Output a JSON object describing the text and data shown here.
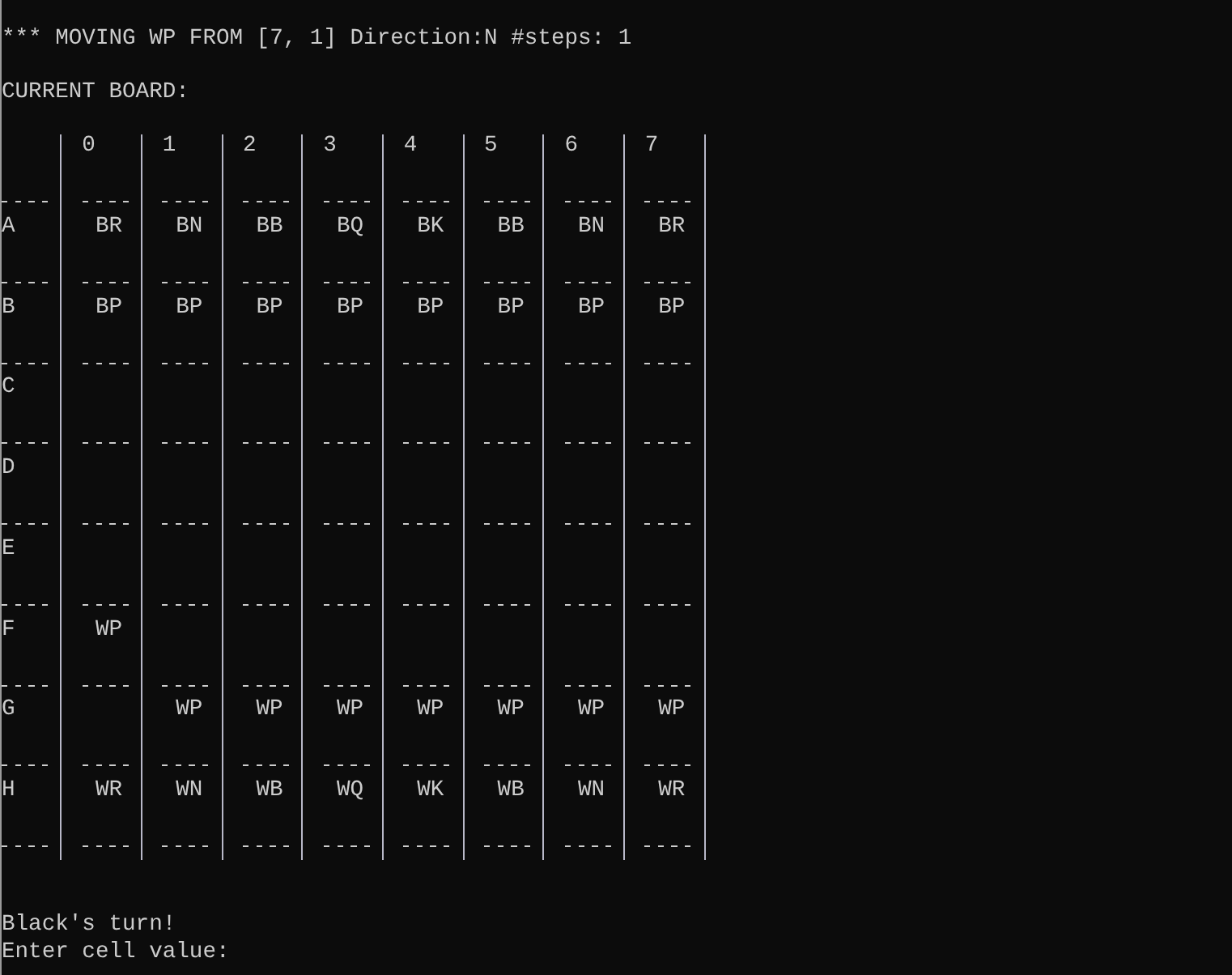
{
  "move_message": "*** MOVING WP FROM [7, 1] Direction:N #steps: 1",
  "board_title": "CURRENT BOARD:",
  "board": {
    "columns": [
      "0",
      "1",
      "2",
      "3",
      "4",
      "5",
      "6",
      "7"
    ],
    "rows": [
      {
        "label": "A",
        "cells": [
          "BR",
          "BN",
          "BB",
          "BQ",
          "BK",
          "BB",
          "BN",
          "BR"
        ]
      },
      {
        "label": "B",
        "cells": [
          "BP",
          "BP",
          "BP",
          "BP",
          "BP",
          "BP",
          "BP",
          "BP"
        ]
      },
      {
        "label": "C",
        "cells": [
          null,
          null,
          null,
          null,
          null,
          null,
          null,
          null
        ]
      },
      {
        "label": "D",
        "cells": [
          null,
          null,
          null,
          null,
          null,
          null,
          null,
          null
        ]
      },
      {
        "label": "E",
        "cells": [
          null,
          null,
          null,
          null,
          null,
          null,
          null,
          null
        ]
      },
      {
        "label": "F",
        "cells": [
          "WP",
          null,
          null,
          null,
          null,
          null,
          null,
          null
        ]
      },
      {
        "label": "G",
        "cells": [
          null,
          "WP",
          "WP",
          "WP",
          "WP",
          "WP",
          "WP",
          "WP"
        ]
      },
      {
        "label": "H",
        "cells": [
          "WR",
          "WN",
          "WB",
          "WQ",
          "WK",
          "WB",
          "WN",
          "WR"
        ]
      }
    ]
  },
  "messages": [
    "Black's turn!",
    "Enter cell value:"
  ]
}
